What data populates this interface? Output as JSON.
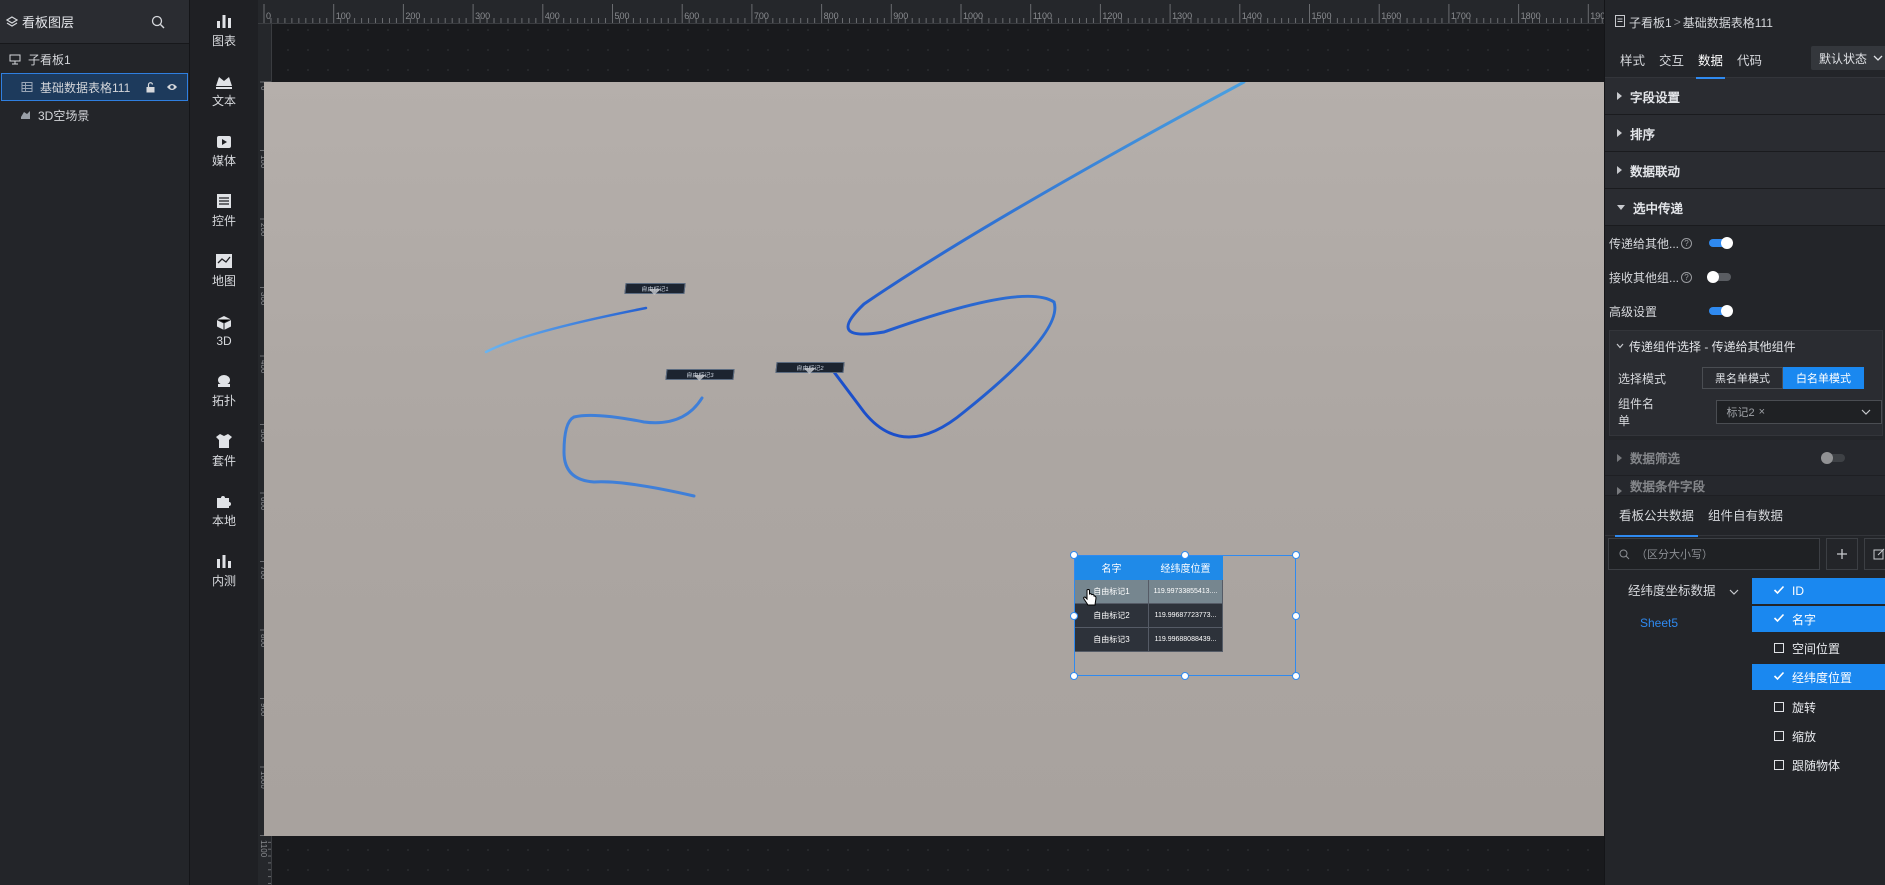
{
  "layers": {
    "title": "看板图层",
    "items": [
      {
        "label": "子看板1",
        "icon": "board-icon"
      },
      {
        "label": "基础数据表格111",
        "icon": "table-icon"
      },
      {
        "label": "3D空场景",
        "icon": "scene-icon"
      }
    ]
  },
  "tools": [
    "图表",
    "文本",
    "媒体",
    "控件",
    "地图",
    "3D",
    "拓扑",
    "套件",
    "本地",
    "内测"
  ],
  "ruler": {
    "top": [
      "0",
      "100",
      "200",
      "300",
      "400",
      "500",
      "600",
      "700",
      "800",
      "900",
      "1000",
      "1100",
      "1200",
      "1300",
      "1400",
      "1500",
      "1600",
      "1700",
      "1800",
      "1900"
    ],
    "left": [
      "0",
      "100",
      "200",
      "300",
      "400",
      "500",
      "600",
      "700",
      "800",
      "900",
      "1000",
      "1100"
    ]
  },
  "markers": [
    "自由标记1",
    "自由标记3",
    "自由标记2"
  ],
  "table": {
    "headers": [
      "名字",
      "经纬度位置"
    ],
    "rows": [
      [
        "自由标记1",
        "119.99733855413...."
      ],
      [
        "自由标记2",
        "119.99687723773..."
      ],
      [
        "自由标记3",
        "119.99688088439..."
      ]
    ]
  },
  "panel": {
    "breadcrumb_root": "子看板1",
    "breadcrumb_sep": ">",
    "breadcrumb_current": "基础数据表格111",
    "tabs": [
      "样式",
      "交互",
      "数据",
      "代码"
    ],
    "state": "默认状态",
    "sections": [
      "字段设置",
      "排序",
      "数据联动",
      "选中传递"
    ],
    "pass_to_others": "传递给其他...",
    "receive_from_others": "接收其他组...",
    "advanced": "高级设置",
    "box_title": "传递组件选择 - 传递给其他组件",
    "select_mode_label": "选择模式",
    "blacklist": "黑名单模式",
    "whitelist": "白名单模式",
    "component_list_label": "组件名单",
    "component_tag": "标记2",
    "tag_close": "×",
    "data_filter": "数据筛选",
    "data_condition": "数据条件字段",
    "data_tabs": [
      "看板公共数据",
      "组件自有数据"
    ],
    "search_placeholder": "（区分大小写）",
    "source": "经纬度坐标数据",
    "sheet": "Sheet5",
    "fields": [
      {
        "label": "ID",
        "checked": true
      },
      {
        "label": "名字",
        "checked": true
      },
      {
        "label": "空间位置",
        "checked": false
      },
      {
        "label": "经纬度位置",
        "checked": true
      },
      {
        "label": "旋转",
        "checked": false
      },
      {
        "label": "缩放",
        "checked": false
      },
      {
        "label": "跟随物体",
        "checked": false
      }
    ]
  }
}
